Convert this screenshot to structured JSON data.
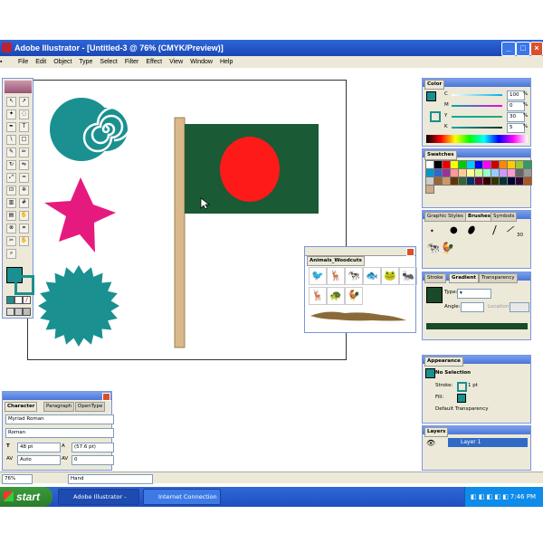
{
  "window": {
    "title": "Adobe Illustrator - [Untitled-3 @ 76% (CMYK/Preview)]"
  },
  "menu": [
    "File",
    "Edit",
    "Object",
    "Type",
    "Select",
    "Filter",
    "Effect",
    "View",
    "Window",
    "Help"
  ],
  "colors": {
    "flag_green": "#1a5a35",
    "flag_red": "#ff1a1a",
    "teal": "#1a9090",
    "magenta": "#e61a7e",
    "pole": "#d9b98a"
  },
  "color_panel": {
    "tab": "Color",
    "channels": [
      {
        "label": "C",
        "value": "100",
        "unit": "%"
      },
      {
        "label": "M",
        "value": "0",
        "unit": "%"
      },
      {
        "label": "Y",
        "value": "30",
        "unit": "%"
      },
      {
        "label": "K",
        "value": "5",
        "unit": "%"
      }
    ]
  },
  "swatches_panel": {
    "tab": "Swatches"
  },
  "brushes_panel": {
    "tabs": [
      "Graphic Styles",
      "Brushes",
      "Symbols"
    ],
    "brush_size": "30"
  },
  "gradient_panel": {
    "tabs": [
      "Stroke",
      "Gradient",
      "Transparency"
    ],
    "type_label": "Type:",
    "angle_label": "Angle:",
    "location_label": "Location"
  },
  "appearance_panel": {
    "tab": "Appearance",
    "selection": "No Selection",
    "stroke_label": "Stroke:",
    "stroke_value": "1 pt",
    "fill_label": "Fill:",
    "transparency": "Default Transparency"
  },
  "layers_panel": {
    "tab": "Layers",
    "layer_name": "Layer 1"
  },
  "animals_panel": {
    "title": "Animals_Woodcuts"
  },
  "character_panel": {
    "tabs": [
      "Character",
      "Paragraph",
      "OpenType"
    ],
    "font": "Myriad Roman",
    "style": "Roman",
    "size": "48 pt",
    "leading": "(57.6 pt)",
    "kerning": "Auto",
    "tracking": "0"
  },
  "statusbar": {
    "zoom": "76%",
    "tool": "Hand"
  },
  "taskbar": {
    "start": "start",
    "items": [
      "Adobe Illustrator - [U...",
      "Internet Connection ..."
    ],
    "clock": "7:46 PM"
  }
}
